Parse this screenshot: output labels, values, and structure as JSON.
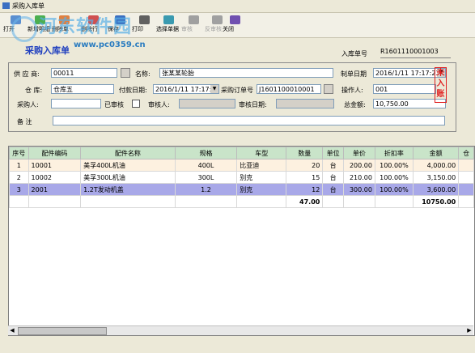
{
  "window": {
    "title": "采购入库单"
  },
  "toolbar": [
    {
      "label": "打开",
      "color": "#5a8fd0",
      "enabled": true
    },
    {
      "label": "新增明细",
      "color": "#4caf50",
      "enabled": true
    },
    {
      "label": "删除单",
      "color": "#e08040",
      "enabled": true
    },
    {
      "label": "删除行",
      "color": "#d05050",
      "enabled": true
    },
    {
      "label": "保存",
      "color": "#3a6fc0",
      "enabled": true
    },
    {
      "label": "打印",
      "color": "#606060",
      "enabled": true
    },
    {
      "label": "选择单据",
      "color": "#3a9ab0",
      "enabled": true
    },
    {
      "label": "审核",
      "color": "#a0a0a0",
      "enabled": false
    },
    {
      "label": "反审核",
      "color": "#a0a0a0",
      "enabled": false
    },
    {
      "label": "关闭",
      "color": "#7050b0",
      "enabled": true
    }
  ],
  "watermark": {
    "title": "河东软件园",
    "url": "www.pc0359.cn"
  },
  "form": {
    "title": "采购入库单",
    "doc_no_label": "入库单号",
    "doc_no": "R1601110001003",
    "stamp": "未入账",
    "supplier_label": "供 应 商:",
    "supplier_code": "00011",
    "name_label": "名称:",
    "supplier_name": "张某某轮胎",
    "date_label": "制单日期",
    "date_value": "2016/1/11 17:17:23",
    "warehouse_label": "仓 库:",
    "warehouse": "仓库五",
    "paydate_label": "付款日期:",
    "paydate": "2016/1/11 17:17:2",
    "po_label": "采购订单号",
    "po": "J1601100010001",
    "operator_label": "操作人:",
    "operator": "001",
    "buyer_label": "采购人:",
    "buyer": "",
    "audited_label": "已审核",
    "auditor_label": "审核人:",
    "auditor": "",
    "auditdate_label": "审核日期:",
    "auditdate": "",
    "total_label": "总金额:",
    "total": "10,750.00",
    "remark_label": "备 注",
    "remark": ""
  },
  "table": {
    "headers": [
      "序号",
      "配件编码",
      "配件名称",
      "规格",
      "车型",
      "数量",
      "单位",
      "单价",
      "折扣率",
      "金额",
      "仓"
    ],
    "rows": [
      [
        "1",
        "10001",
        "美孚400L机油",
        "400L",
        "比亚迪",
        "20",
        "台",
        "200.00",
        "100.00%",
        "4,000.00",
        ""
      ],
      [
        "2",
        "10002",
        "美孚300L机油",
        "300L",
        "别克",
        "15",
        "台",
        "210.00",
        "100.00%",
        "3,150.00",
        ""
      ],
      [
        "3",
        "2001",
        "1.2T发动机盖",
        "1.2",
        "别克",
        "12",
        "台",
        "300.00",
        "100.00%",
        "3,600.00",
        ""
      ]
    ],
    "totals": {
      "qty": "47.00",
      "amount": "10750.00"
    }
  }
}
